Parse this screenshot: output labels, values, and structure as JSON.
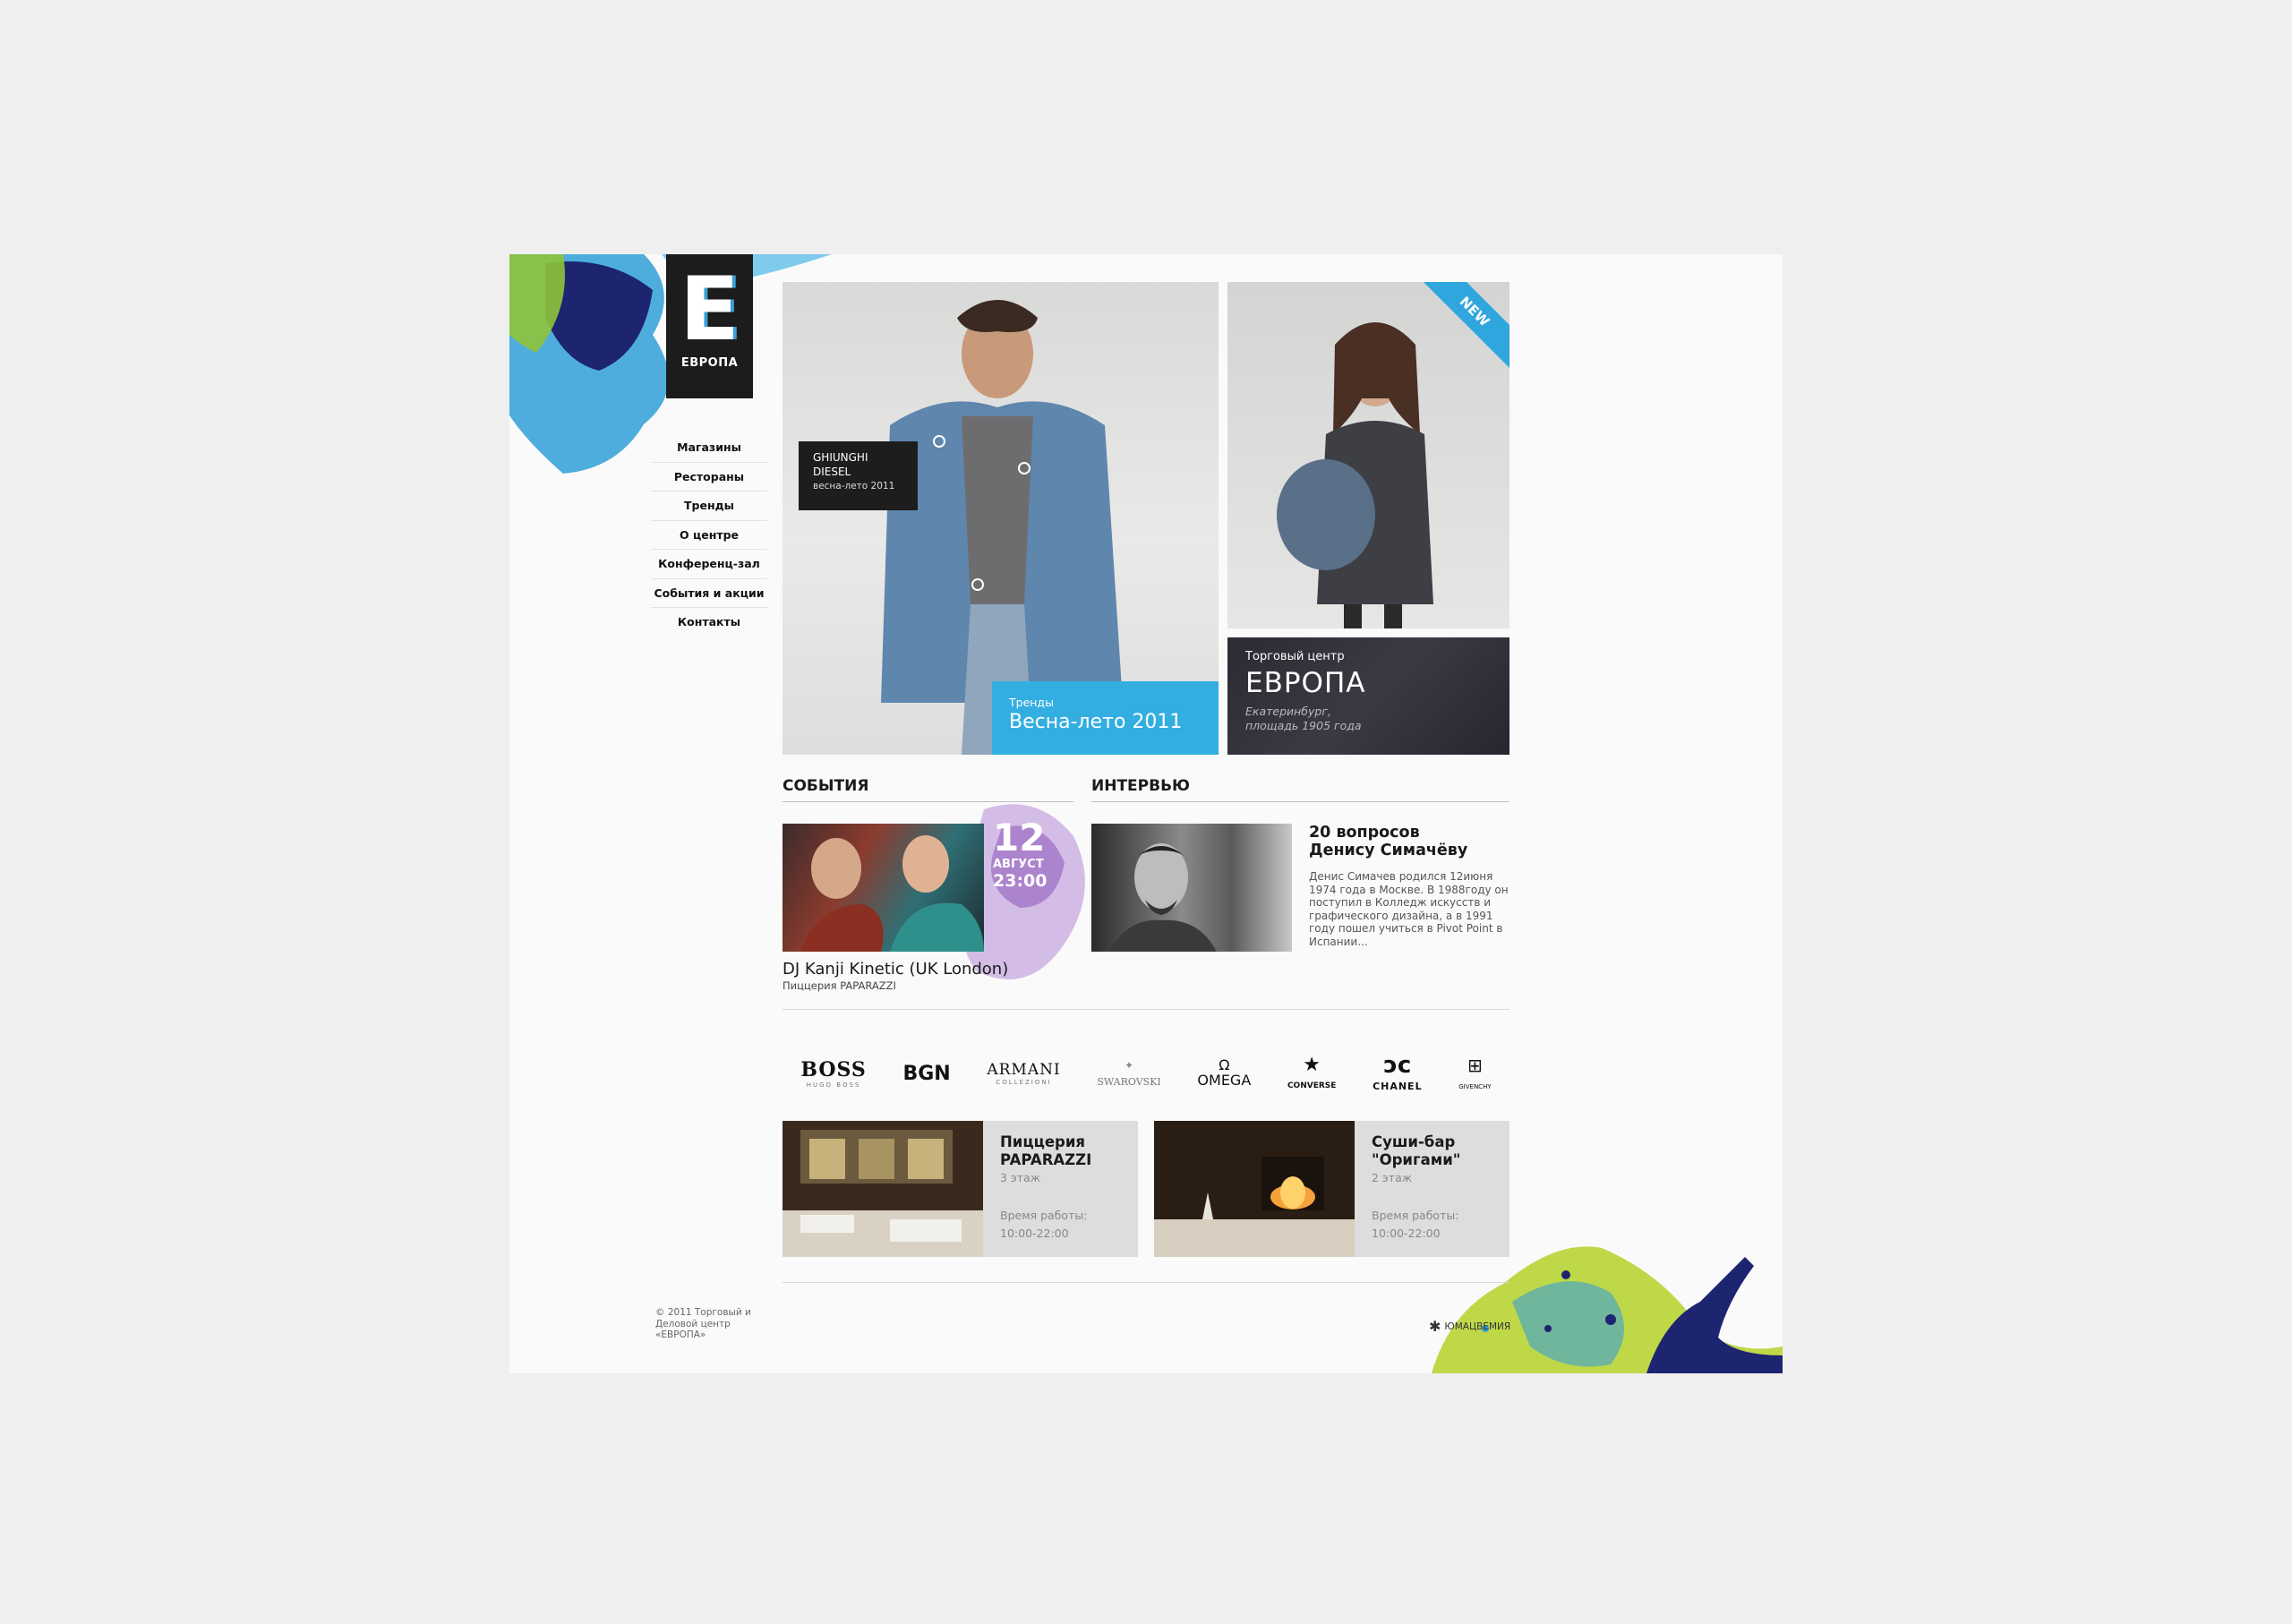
{
  "logo": {
    "letter": "E",
    "name": "ЕВРОПА"
  },
  "nav": {
    "items": [
      "Магазины",
      "Рестораны",
      "Тренды",
      "О центре",
      "Конференц-зал",
      "События и акции",
      "Контакты"
    ]
  },
  "hero": {
    "tag_line1": "GHIUNGHI",
    "tag_line2": "DIESEL",
    "tag_line3": "весна-лето 2011",
    "blue_small": "Тренды",
    "blue_big": "Весна-лето 2011",
    "ribbon": "NEW",
    "mall_small": "Торговый центр",
    "mall_big": "ЕВРОПА",
    "mall_addr1": "Екатеринбург,",
    "mall_addr2": "площадь 1905 года"
  },
  "events": {
    "title": "СОБЫТИЯ",
    "day": "12",
    "month": "АВГУСТ",
    "time": "23:00",
    "event_title": "DJ Kanji Kinetic (UK London)",
    "place": "Пиццерия PAPARAZZI"
  },
  "interview": {
    "title": "ИНТЕРВЬЮ",
    "headline1": "20 вопросов",
    "headline2": "Денису Симачёву",
    "text": "Денис Симачев родился 12июня 1974 года в Москве. В 1988году он поступил в Колледж искусств и графического дизайна, а в 1991 году пошел учиться в Pivot Point в Испании..."
  },
  "brands": {
    "boss": "BOSS",
    "boss_sub": "HUGO BOSS",
    "bgn": "BGN",
    "armani": "ARMANI",
    "armani_sub": "COLLEZIONI",
    "swarovski": "SWAROVSKI",
    "omega": "OMEGA",
    "converse": "CONVERSE",
    "chanel": "CHANEL",
    "givenchy": "GIVENCHY"
  },
  "restaurants": [
    {
      "name1": "Пиццерия",
      "name2": "PAPARAZZI",
      "floor": "3 этаж",
      "hours_label": "Время работы:",
      "hours": "10:00-22:00"
    },
    {
      "name1": "Суши-бар",
      "name2": "\"Оригами\"",
      "floor": "2 этаж",
      "hours_label": "Время работы:",
      "hours": "10:00-22:00"
    }
  ],
  "footer": {
    "copy1": "© 2011 Торговый и",
    "copy2": "Деловой центр",
    "copy3": "«ЕВРОПА»",
    "developer": "ЮМАЦВЕМИЯ"
  },
  "colors": {
    "accent_blue": "#33aee1",
    "dark": "#1c1c1c",
    "splash_green": "#b7d434",
    "splash_navy": "#1c1f6b",
    "splash_orange": "#f07a2a"
  }
}
